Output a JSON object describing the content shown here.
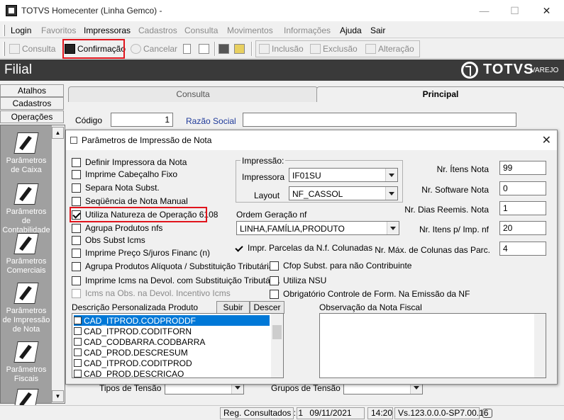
{
  "window": {
    "title": "TOTVS Homecenter (Linha Gemco) -"
  },
  "menu": [
    {
      "label": "Login",
      "enabled": true
    },
    {
      "label": "Favoritos",
      "enabled": false
    },
    {
      "label": "Impressoras",
      "enabled": true
    },
    {
      "label": "Cadastros",
      "enabled": false
    },
    {
      "label": "Consulta",
      "enabled": false
    },
    {
      "label": "Movimentos",
      "enabled": false
    },
    {
      "label": "Informações",
      "enabled": false
    },
    {
      "label": "Ajuda",
      "enabled": true
    },
    {
      "label": "Sair",
      "enabled": true
    }
  ],
  "toolbar": {
    "consulta": "Consulta",
    "confirmacao": "Confirmação",
    "cancelar": "Cancelar",
    "inclusao": "Inclusão",
    "exclusao": "Exclusão",
    "alteracao": "Alteração"
  },
  "header": {
    "title": "Filial",
    "brand": "TOTVS",
    "brand_sub": "VAREJO"
  },
  "left_panel": {
    "buttons": [
      "Atalhos",
      "Cadastros",
      "Operações"
    ],
    "items": [
      "Parâmetros de Caixa",
      "Parâmetros de Contabilidade",
      "Parâmetros Comerciais",
      "Parâmetros de Impressão de Nota",
      "Parâmetros Fiscais"
    ]
  },
  "main": {
    "tabs": [
      "Consulta",
      "Principal"
    ],
    "codigo_label": "Código",
    "codigo_value": "1",
    "razao_label": "Razão Social",
    "tipos_tensao_label": "Tipos de Tensão",
    "grupos_tensao_label": "Grupos de Tensão"
  },
  "dialog": {
    "title": "Parâmetros de Impressão de Nota",
    "checkboxes": [
      {
        "label": "Definir Impressora da Nota",
        "checked": false,
        "enabled": true
      },
      {
        "label": "Imprime Cabeçalho Fixo",
        "checked": false,
        "enabled": true
      },
      {
        "label": "Separa Nota Subst.",
        "checked": false,
        "enabled": true
      },
      {
        "label": "Seqüência de Nota  Manual",
        "checked": false,
        "enabled": true
      },
      {
        "label": "Utiliza Natureza de Operação 6108",
        "checked": true,
        "enabled": true
      },
      {
        "label": "Agrupa Produtos nfs",
        "checked": false,
        "enabled": true
      },
      {
        "label": "Obs Subst Icms",
        "checked": false,
        "enabled": true
      },
      {
        "label": "Imprime Preço S/juros Financ (n)",
        "checked": false,
        "enabled": true
      },
      {
        "label": "Agrupa Produtos Alíquota / Substituição Tributária",
        "checked": false,
        "enabled": true
      },
      {
        "label": "Imprime Icms na Devol. com Substituição Tributária",
        "checked": false,
        "enabled": true
      },
      {
        "label": "Icms na Obs. na Devol. Incentivo Icms",
        "checked": false,
        "enabled": false
      }
    ],
    "impressao": {
      "group_label": "Impressão:",
      "impressora_label": "Impressora",
      "impressora_value": "IF01SU",
      "layout_label": "Layout",
      "layout_value": "NF_CASSOL"
    },
    "ordem": {
      "label": "Ordem Geração nf",
      "value": "LINHA,FAMÍLIA,PRODUTO"
    },
    "mid_checkboxes": [
      {
        "label": "Impr. Parcelas da N.f. Colunadas",
        "checked": true
      },
      {
        "label": "Cfop Subst. para não Contribuinte",
        "checked": false
      },
      {
        "label": "Utiliza NSU",
        "checked": false
      },
      {
        "label": "Obrigatório Controle de Form. Na Emissão da NF",
        "checked": false
      }
    ],
    "numeric_fields": [
      {
        "label": "Nr. Ítens Nota",
        "value": "99"
      },
      {
        "label": "Nr. Software Nota",
        "value": "0"
      },
      {
        "label": "Nr. Dias Reemis. Nota",
        "value": "1"
      },
      {
        "label": "Nr. Itens p/ Imp. nf",
        "value": "20"
      },
      {
        "label": "Nr. Máx. de Colunas das Parc.",
        "value": "4"
      }
    ],
    "descricao": {
      "label": "Descrição Personalizada Produto",
      "subir": "Subir",
      "descer": "Descer",
      "items": [
        "CAD_ITPROD.CODPRODDF",
        "CAD_ITPROD.CODITFORN",
        "CAD_CODBARRA.CODBARRA",
        "CAD_PROD.DESCRESUM",
        "CAD_ITPROD.CODITPROD",
        "CAD_PROD.DESCRICAO"
      ],
      "selected_index": 0
    },
    "observacao_label": "Observação da Nota Fiscal"
  },
  "status": {
    "registros": "Reg. Consultados : 1",
    "data": "09/11/2021",
    "hora": "14:20",
    "versao": "Vs.123.0.0.0-SP7.00.16"
  },
  "colors": {
    "highlight_red": "#e0141c",
    "selection_blue": "#0078d7",
    "header_dark": "#3a3a3a",
    "link_blue": "#1f3a9a"
  }
}
